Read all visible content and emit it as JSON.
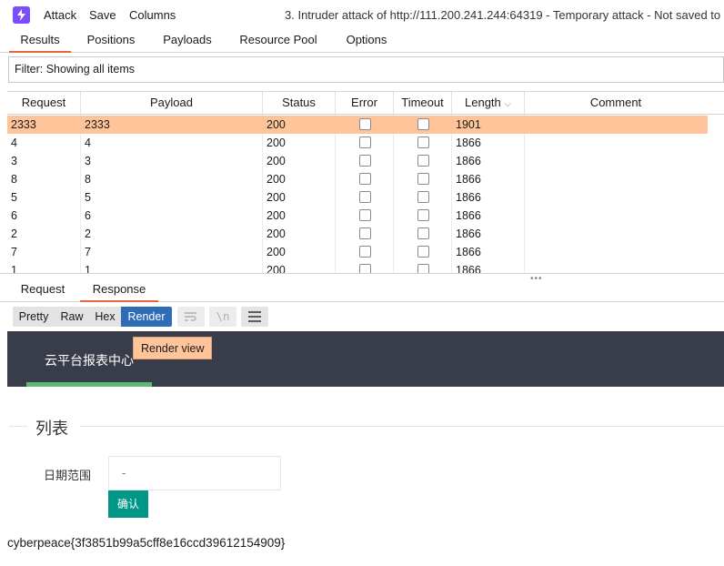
{
  "menu": {
    "attack": "Attack",
    "save": "Save",
    "columns": "Columns",
    "window_title": "3. Intruder attack of http://111.200.241.244:64319 - Temporary attack - Not saved to"
  },
  "tabs": [
    "Results",
    "Positions",
    "Payloads",
    "Resource Pool",
    "Options"
  ],
  "filter": "Filter: Showing all items",
  "table": {
    "columns": [
      "Request",
      "Payload",
      "Status",
      "Error",
      "Timeout",
      "Length",
      "Comment"
    ],
    "sort_indicator": "⌵",
    "rows": [
      {
        "request": "2333",
        "payload": "2333",
        "status": "200",
        "error": false,
        "timeout": false,
        "length": "1901",
        "comment": "",
        "selected": true
      },
      {
        "request": "4",
        "payload": "4",
        "status": "200",
        "error": false,
        "timeout": false,
        "length": "1866",
        "comment": ""
      },
      {
        "request": "3",
        "payload": "3",
        "status": "200",
        "error": false,
        "timeout": false,
        "length": "1866",
        "comment": ""
      },
      {
        "request": "8",
        "payload": "8",
        "status": "200",
        "error": false,
        "timeout": false,
        "length": "1866",
        "comment": ""
      },
      {
        "request": "5",
        "payload": "5",
        "status": "200",
        "error": false,
        "timeout": false,
        "length": "1866",
        "comment": ""
      },
      {
        "request": "6",
        "payload": "6",
        "status": "200",
        "error": false,
        "timeout": false,
        "length": "1866",
        "comment": ""
      },
      {
        "request": "2",
        "payload": "2",
        "status": "200",
        "error": false,
        "timeout": false,
        "length": "1866",
        "comment": ""
      },
      {
        "request": "7",
        "payload": "7",
        "status": "200",
        "error": false,
        "timeout": false,
        "length": "1866",
        "comment": ""
      },
      {
        "request": "1",
        "payload": "1",
        "status": "200",
        "error": false,
        "timeout": false,
        "length": "1866",
        "comment": ""
      }
    ]
  },
  "subtabs": [
    "Request",
    "Response"
  ],
  "view_buttons": [
    "Pretty",
    "Raw",
    "Hex",
    "Render"
  ],
  "icons": {
    "app": "burp-lightning-icon",
    "wrap": "word-wrap-icon",
    "newline": "newline-icon",
    "menu": "hamburger-menu-icon"
  },
  "icon_glyphs": {
    "newline": "\\n"
  },
  "tooltip": "Render view",
  "render": {
    "brand": "云平台报表中心",
    "legend": "列表",
    "date_label": "日期范围",
    "date_value": "-",
    "confirm_button": "确认",
    "flag": "cyberpeace{3f3851b99a5cff8e16ccd39612154909}"
  },
  "colors": {
    "accent": "#e8643a",
    "selected_row": "#ffc499",
    "render_active": "#2e6db6",
    "page_header": "#393d49",
    "header_underline": "#5fb878",
    "confirm": "#009688"
  }
}
